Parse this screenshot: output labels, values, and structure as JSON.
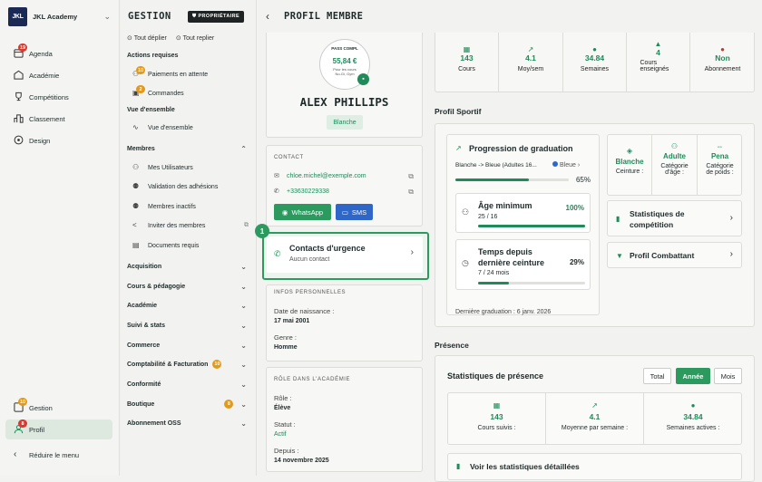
{
  "sidebar": {
    "academy": "JKL Academy",
    "logo": "JKL",
    "items": [
      {
        "label": "Agenda",
        "badge": "19",
        "icon": "calendar-icon"
      },
      {
        "label": "Académie",
        "icon": "building-icon"
      },
      {
        "label": "Compétitions",
        "icon": "trophy-icon"
      },
      {
        "label": "Classement",
        "icon": "ranking-icon"
      },
      {
        "label": "Design",
        "icon": "palette-icon"
      }
    ],
    "bottom": [
      {
        "label": "Gestion",
        "badge": "10",
        "icon": "grid-icon"
      },
      {
        "label": "Profil",
        "badge": "8",
        "icon": "user-icon"
      }
    ],
    "reduce": "Réduire le menu"
  },
  "menu": {
    "title": "GESTION",
    "owner": "PROPRIÉTAIRE",
    "expand": "Tout déplier",
    "collapse": "Tout replier",
    "actions_title": "Actions requises",
    "actions": [
      {
        "label": "Paiements en attente",
        "badge": "10"
      },
      {
        "label": "Commandes",
        "badge": "2"
      }
    ],
    "overview_title": "Vue d'ensemble",
    "overview": "Vue d'ensemble",
    "members_title": "Membres",
    "members": [
      "Mes Utilisateurs",
      "Validation des adhésions",
      "Membres inactifs",
      "Inviter des membres",
      "Documents requis"
    ],
    "groups": [
      {
        "label": "Acquisition"
      },
      {
        "label": "Cours & pédagogie"
      },
      {
        "label": "Académie"
      },
      {
        "label": "Suivi & stats"
      },
      {
        "label": "Commerce"
      },
      {
        "label": "Comptabilité & Facturation",
        "badge": "10"
      },
      {
        "label": "Conformité"
      },
      {
        "label": "Boutique",
        "badge": "8"
      },
      {
        "label": "Abonnement OSS"
      }
    ]
  },
  "page": {
    "title": "PROFIL MEMBRE"
  },
  "profile": {
    "name": "ALEX PHILLIPS",
    "belt": "Blanche",
    "pass_title": "PASS COMPL",
    "pass_amount": "55,84 €",
    "pass_sub1": "Pour les cours",
    "pass_sub2": "No-Gi, Gym"
  },
  "contact": {
    "title": "CONTACT",
    "email": "chloe.michel@exemple.com",
    "phone": "+33630229338",
    "whatsapp": "WhatsApp",
    "sms": "SMS"
  },
  "emergency": {
    "step": "1",
    "title": "Contacts d'urgence",
    "subtitle": "Aucun contact"
  },
  "personal": {
    "title": "INFOS PERSONNELLES",
    "birth_label": "Date de naissance :",
    "birth": "17 mai 2001",
    "gender_label": "Genre :",
    "gender": "Homme"
  },
  "role": {
    "title": "RÔLE DANS L'ACADÉMIE",
    "role_label": "Rôle :",
    "role": "Élève",
    "status_label": "Statut :",
    "status": "Actif",
    "since_label": "Depuis :",
    "since": "14 novembre 2025"
  },
  "stats": [
    {
      "value": "143",
      "label": "Cours",
      "icon": "calendar-icon"
    },
    {
      "value": "4.1",
      "label": "Moy/sem",
      "icon": "trend-icon"
    },
    {
      "value": "34.84",
      "label": "Semaines",
      "icon": "clock-icon"
    },
    {
      "value": "4",
      "label": "Cours enseignés",
      "icon": "graduation-icon"
    },
    {
      "value": "Non",
      "label": "Abonnement",
      "icon": "x-circle-icon"
    }
  ],
  "sport": {
    "title": "Profil Sportif",
    "grad_title": "Progression de graduation",
    "grad_path": "Blanche -> Bleue (Adultes 16...",
    "grad_target": "Bleue",
    "grad_pct": "65%",
    "grad_value": 0.65,
    "age_title": "Âge minimum",
    "age_val": "25 / 16",
    "age_pct": "100%",
    "age_value": 1.0,
    "time_title1": "Temps depuis",
    "time_title2": "dernière ceinture",
    "time_val": "7 / 24 mois",
    "time_pct": "29%",
    "time_value": 0.29,
    "last_grad": "Dernière graduation : 6 janv. 2026",
    "belt": {
      "value": "Blanche",
      "label": "Ceinture :"
    },
    "age_cat": {
      "value": "Adulte",
      "label1": "Catégorie",
      "label2": "d'âge :"
    },
    "weight": {
      "value": "Pena",
      "label1": "Catégorie",
      "label2": "de poids :"
    },
    "comp_stats1": "Statistiques de",
    "comp_stats2": "compétition",
    "fighter": "Profil Combattant"
  },
  "presence": {
    "title": "Présence",
    "stats_title": "Statistiques de présence",
    "tabs": [
      "Total",
      "Année",
      "Mois"
    ],
    "active_tab": "Année",
    "items": [
      {
        "value": "143",
        "label": "Cours suivis :"
      },
      {
        "value": "4.1",
        "label": "Moyenne par semaine :"
      },
      {
        "value": "34.84",
        "label": "Semaines actives :"
      }
    ],
    "details": "Voir les statistiques détaillées"
  }
}
